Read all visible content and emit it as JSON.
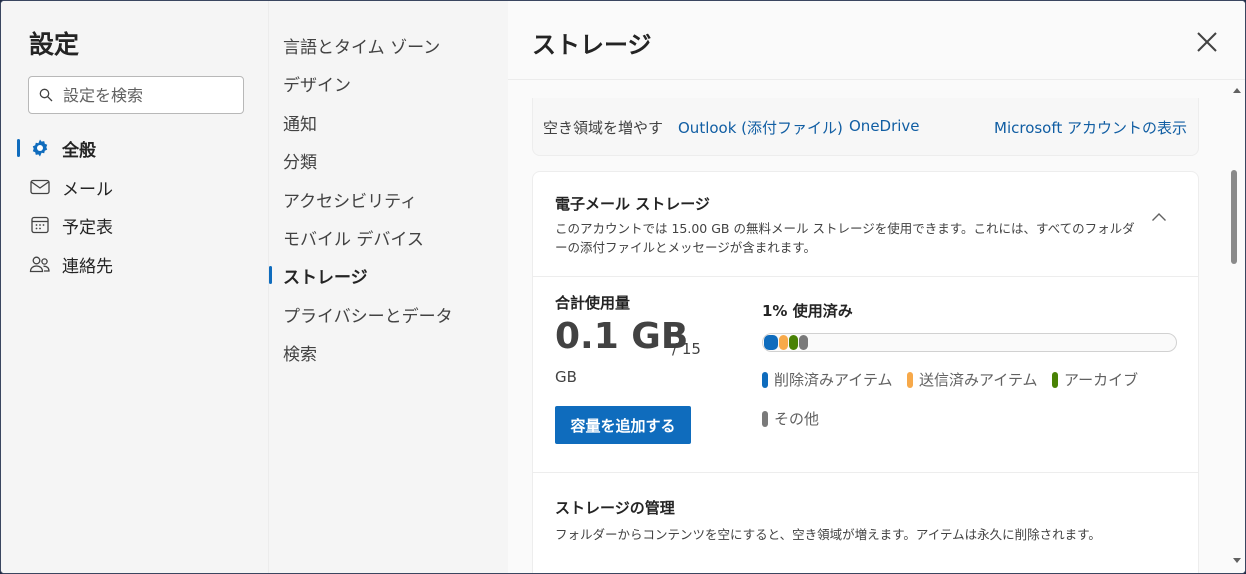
{
  "settings": {
    "title": "設定",
    "search_placeholder": "設定を検索"
  },
  "nav1": {
    "items": [
      {
        "label": "全般",
        "icon": "gear-icon",
        "active": true
      },
      {
        "label": "メール",
        "icon": "mail-icon"
      },
      {
        "label": "予定表",
        "icon": "calendar-icon"
      },
      {
        "label": "連絡先",
        "icon": "people-icon"
      }
    ]
  },
  "nav2": {
    "items": [
      {
        "label": "言語とタイム ゾーン"
      },
      {
        "label": "デザイン"
      },
      {
        "label": "通知"
      },
      {
        "label": "分類"
      },
      {
        "label": "アクセシビリティ"
      },
      {
        "label": "モバイル デバイス"
      },
      {
        "label": "ストレージ",
        "active": true
      },
      {
        "label": "プライバシーとデータ"
      },
      {
        "label": "検索"
      }
    ]
  },
  "content": {
    "title": "ストレージ",
    "free_space": {
      "label": "空き領域を増やす",
      "links": [
        "Outlook (添付ファイル)",
        "OneDrive",
        "Microsoft アカウントの表示"
      ]
    },
    "email_storage": {
      "title": "電子メール ストレージ",
      "description": "このアカウントでは 15.00 GB の無料メール ストレージを使用できます。これには、すべてのフォルダーの添付ファイルとメッセージが含まれます。",
      "total_label": "合計使用量",
      "total_value": "0.1 GB",
      "total_of": "/ 15",
      "total_unit": "GB",
      "add_button": "容量を追加する",
      "used_label": "1% 使用済み",
      "legend": [
        {
          "label": "削除済みアイテム",
          "color": "#0f6cbd"
        },
        {
          "label": "送信済みアイテム",
          "color": "#f7a94a"
        },
        {
          "label": "アーカイブ",
          "color": "#498205"
        },
        {
          "label": "その他",
          "color": "#7a7a7a"
        }
      ]
    },
    "management": {
      "title": "ストレージの管理",
      "description": "フォルダーからコンテンツを空にすると、空き領域が増えます。アイテムは永久に削除されます。"
    }
  },
  "colors": {
    "accent": "#0f6cbd",
    "link": "#115ea3"
  }
}
